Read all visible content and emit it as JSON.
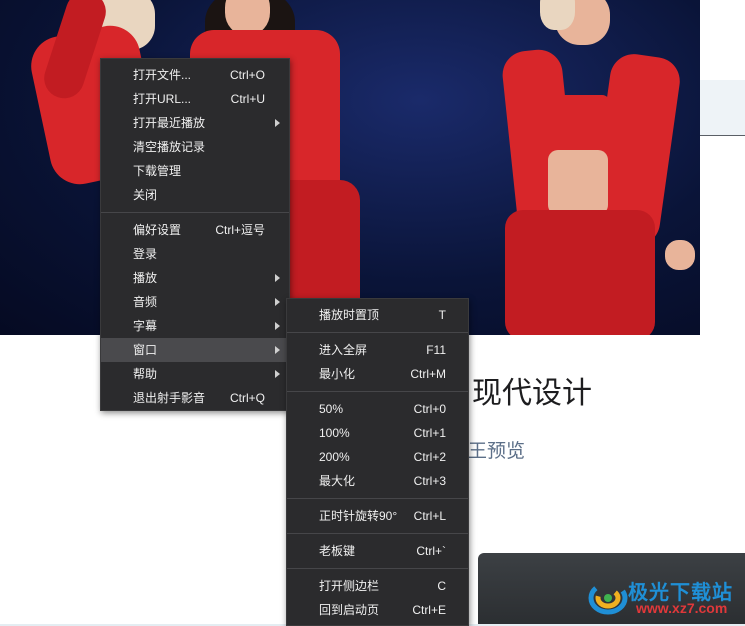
{
  "page": {
    "title": "现代设计",
    "subtitle": "王预览"
  },
  "watermark": {
    "brand": "极光下载站",
    "url": "www.xz7.com"
  },
  "main_menu": {
    "items": [
      {
        "label": "打开文件...",
        "shortcut": "Ctrl+O"
      },
      {
        "label": "打开URL...",
        "shortcut": "Ctrl+U"
      },
      {
        "label": "打开最近播放",
        "shortcut": ""
      },
      {
        "label": "清空播放记录",
        "shortcut": ""
      },
      {
        "label": "下载管理",
        "shortcut": ""
      },
      {
        "label": "关闭",
        "shortcut": ""
      },
      {
        "label": "偏好设置",
        "shortcut": "Ctrl+逗号"
      },
      {
        "label": "登录",
        "shortcut": ""
      },
      {
        "label": "播放",
        "shortcut": ""
      },
      {
        "label": "音频",
        "shortcut": ""
      },
      {
        "label": "字幕",
        "shortcut": ""
      },
      {
        "label": "窗口",
        "shortcut": ""
      },
      {
        "label": "帮助",
        "shortcut": ""
      },
      {
        "label": "退出射手影音",
        "shortcut": "Ctrl+Q"
      }
    ]
  },
  "window_submenu": {
    "items": [
      {
        "label": "播放时置顶",
        "shortcut": "T"
      },
      {
        "label": "进入全屏",
        "shortcut": "F11"
      },
      {
        "label": "最小化",
        "shortcut": "Ctrl+M"
      },
      {
        "label": "50%",
        "shortcut": "Ctrl+0"
      },
      {
        "label": "100%",
        "shortcut": "Ctrl+1"
      },
      {
        "label": "200%",
        "shortcut": "Ctrl+2"
      },
      {
        "label": "最大化",
        "shortcut": "Ctrl+3"
      },
      {
        "label": "正时针旋转90°",
        "shortcut": "Ctrl+L"
      },
      {
        "label": "老板键",
        "shortcut": "Ctrl+`"
      },
      {
        "label": "打开侧边栏",
        "shortcut": "C"
      },
      {
        "label": "回到启动页",
        "shortcut": "Ctrl+E"
      }
    ]
  },
  "colors": {
    "menu_bg": "#2b2b2d",
    "menu_highlight": "#4a4a4d",
    "menu_text": "#f0f0f0",
    "video_bg": "#0a1438",
    "costume_red": "#d8262a"
  },
  "icons": {
    "submenu_arrow": "chevron-right-icon"
  }
}
